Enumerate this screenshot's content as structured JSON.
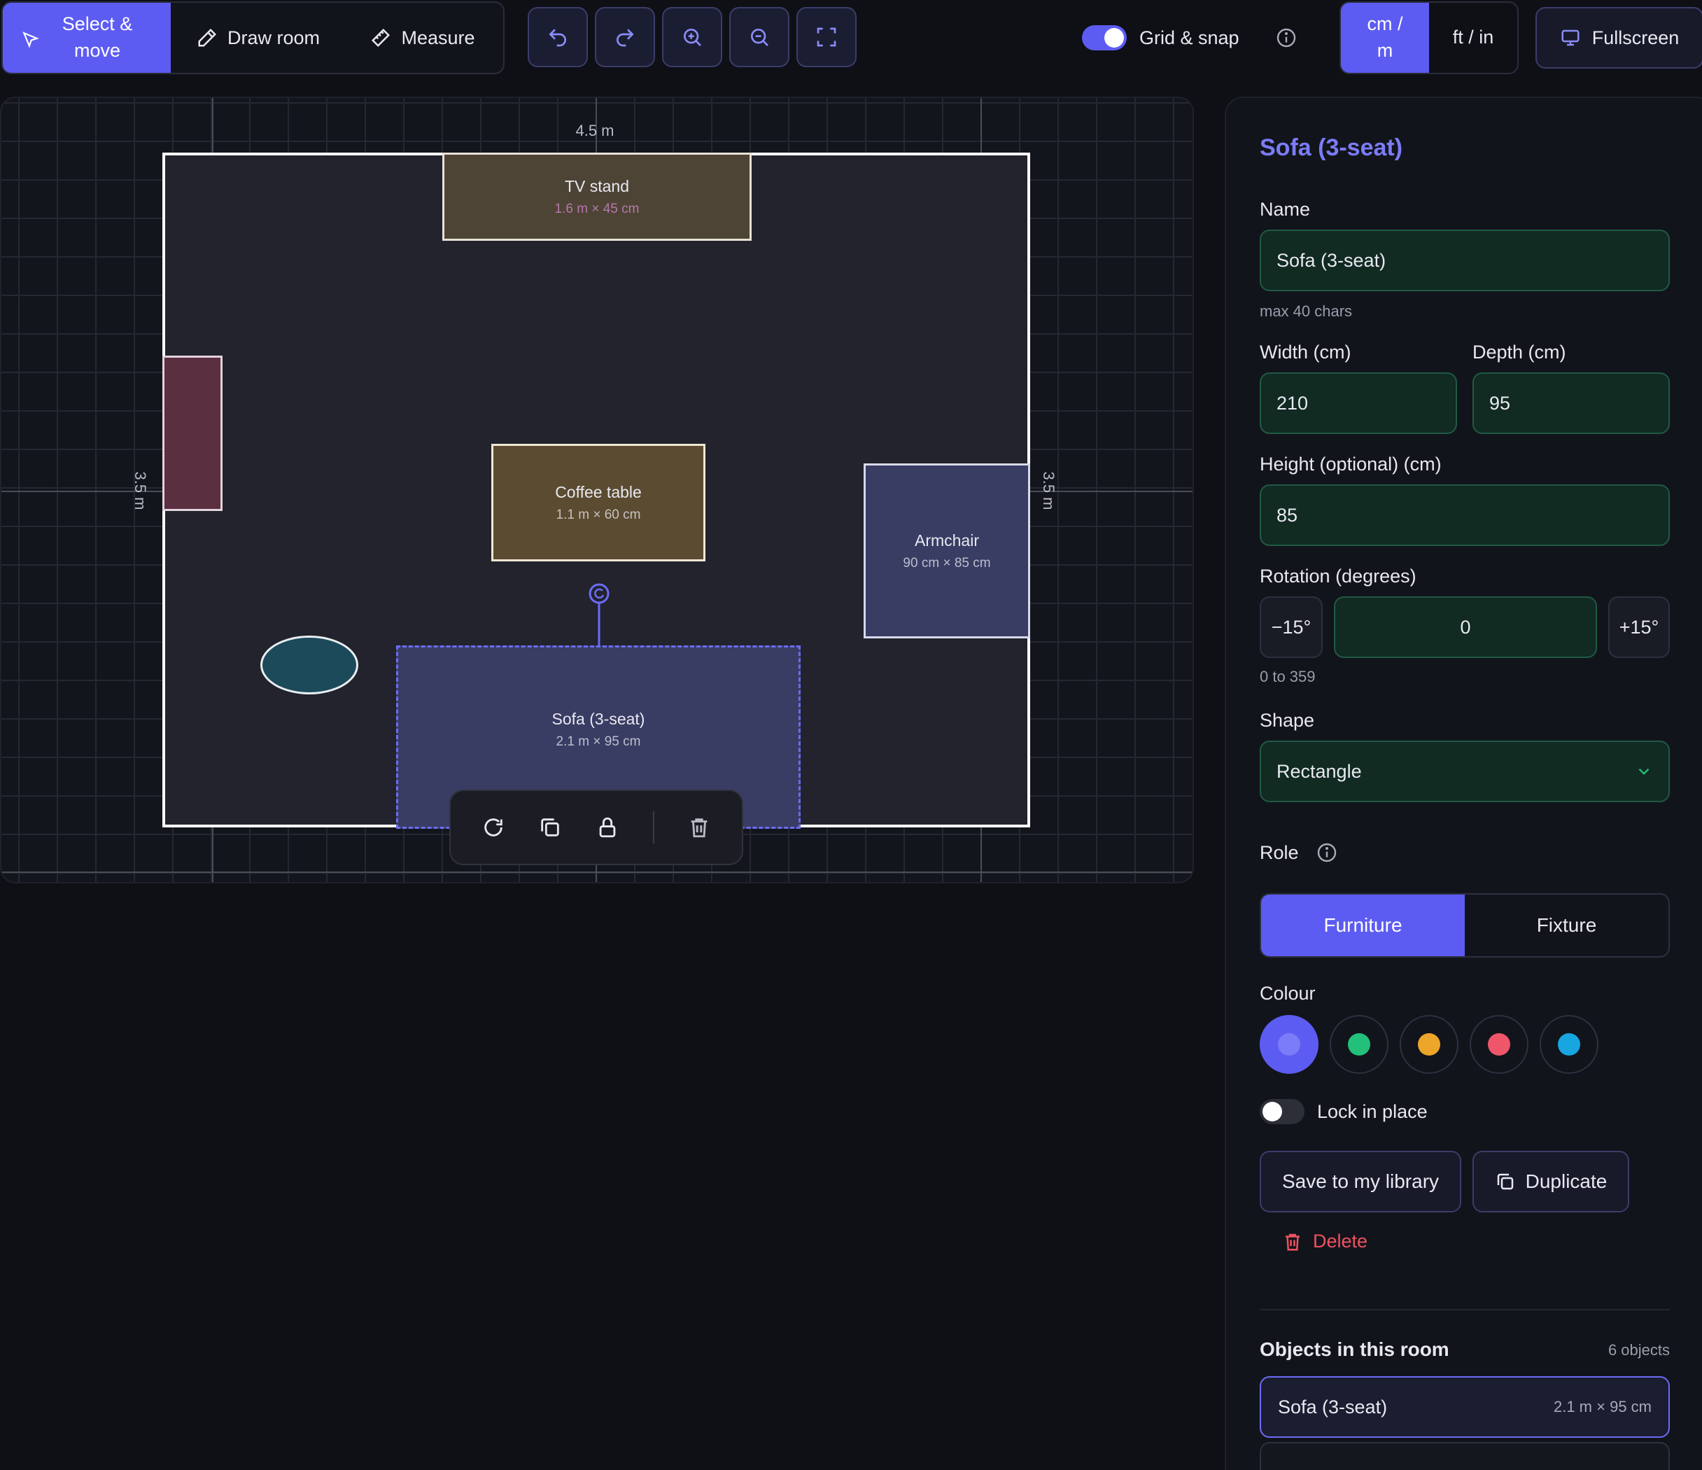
{
  "toolbar": {
    "modes": {
      "select": "Select & move",
      "draw": "Draw room",
      "measure": "Measure"
    },
    "grid_snap_label": "Grid & snap",
    "grid_snap_on": true,
    "units": {
      "metric": "cm / m",
      "imperial": "ft / in"
    },
    "fullscreen_label": "Fullscreen",
    "icons": [
      "undo-icon",
      "redo-icon",
      "zoom-in-icon",
      "zoom-out-icon",
      "fit-screen-icon"
    ]
  },
  "canvas": {
    "room_width_label": "4.5 m",
    "room_depth_label": "3.5 m",
    "room_depth_label_right": "3.5 m",
    "items": {
      "tv_stand": {
        "name": "TV stand",
        "dims": "1.6 m × 45 cm"
      },
      "coffee_table": {
        "name": "Coffee table",
        "dims": "1.1 m × 60 cm"
      },
      "armchair": {
        "name": "Armchair",
        "dims": "90 cm × 85 cm"
      },
      "sofa": {
        "name": "Sofa (3-seat)",
        "dims": "2.1 m × 95 cm"
      }
    }
  },
  "panel": {
    "title": "Sofa (3-seat)",
    "name_label": "Name",
    "name_value": "Sofa (3-seat)",
    "name_hint": "max 40 chars",
    "width_label": "Width (cm)",
    "width_value": "210",
    "depth_label": "Depth (cm)",
    "depth_value": "95",
    "height_label": "Height (optional) (cm)",
    "height_value": "85",
    "rotation_label": "Rotation (degrees)",
    "rotation_minus": "−15°",
    "rotation_value": "0",
    "rotation_plus": "+15°",
    "rotation_hint": "0 to 359",
    "shape_label": "Shape",
    "shape_value": "Rectangle",
    "role_label": "Role",
    "role_options": {
      "furniture": "Furniture",
      "fixture": "Fixture"
    },
    "role_selected": "Furniture",
    "colour_label": "Colour",
    "colours": [
      "#6b6cf5",
      "#22c07a",
      "#eda52a",
      "#f0566a",
      "#17a6e0"
    ],
    "lock_label": "Lock in place",
    "lock_on": false,
    "save_label": "Save to my library",
    "duplicate_label": "Duplicate",
    "delete_label": "Delete",
    "objects_title": "Objects in this room",
    "objects_count": "6 objects",
    "objects": [
      {
        "name": "Sofa (3-seat)",
        "dims": "2.1 m × 95 cm"
      }
    ]
  },
  "colors": {
    "accent": "#5d5cf2",
    "danger": "#ef5161",
    "field_border": "#1f5a44"
  }
}
